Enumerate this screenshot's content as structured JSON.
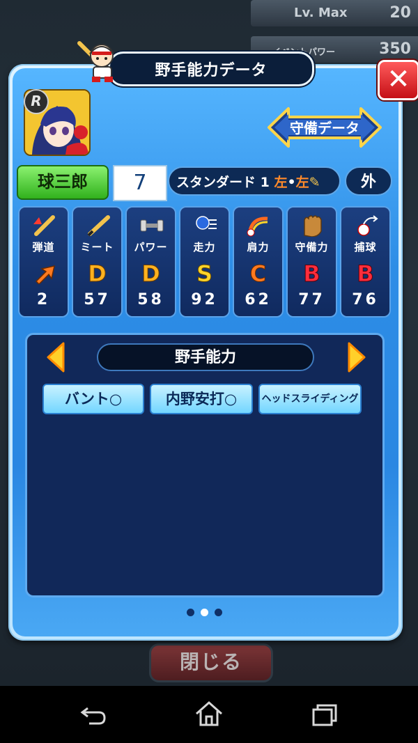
{
  "background": {
    "level_label": "Lv. Max",
    "level_value": "20",
    "event_power_label": "イベントパワー",
    "event_power_value": "350",
    "close_label": "閉じる"
  },
  "dialog": {
    "title": "野手能力データ",
    "close_icon": "close-x-icon",
    "defense_button": "守備データ",
    "rarity_badge": "R",
    "player_name": "球三郎",
    "uniform_number": "7",
    "style_label": "スタンダード 1",
    "hand": "左",
    "position": "外"
  },
  "stats": [
    {
      "label": "弾道",
      "icon": "trajectory-icon",
      "grade": "",
      "value": "2"
    },
    {
      "label": "ミート",
      "icon": "bat-icon",
      "grade": "D",
      "value": "57"
    },
    {
      "label": "パワー",
      "icon": "dumbbell-icon",
      "grade": "D",
      "value": "58"
    },
    {
      "label": "走力",
      "icon": "running-icon",
      "grade": "S",
      "value": "92"
    },
    {
      "label": "肩力",
      "icon": "throw-arc-icon",
      "grade": "C",
      "value": "62"
    },
    {
      "label": "守備力",
      "icon": "glove-icon",
      "grade": "B",
      "value": "77"
    },
    {
      "label": "捕球",
      "icon": "catch-icon",
      "grade": "B",
      "value": "76"
    }
  ],
  "abilities": {
    "header": "野手能力",
    "items": [
      "バント○",
      "内野安打○",
      "ヘッドスライディング"
    ]
  },
  "pagination": {
    "pages": 3,
    "current": 2
  },
  "colors": {
    "dialog_blue": "#2d8de6",
    "stat_panel": "#102a5f",
    "grade_D": "#ffb21f",
    "grade_S": "#ffd52a",
    "grade_C": "#ff7a1f",
    "grade_B": "#ff2d3c"
  }
}
